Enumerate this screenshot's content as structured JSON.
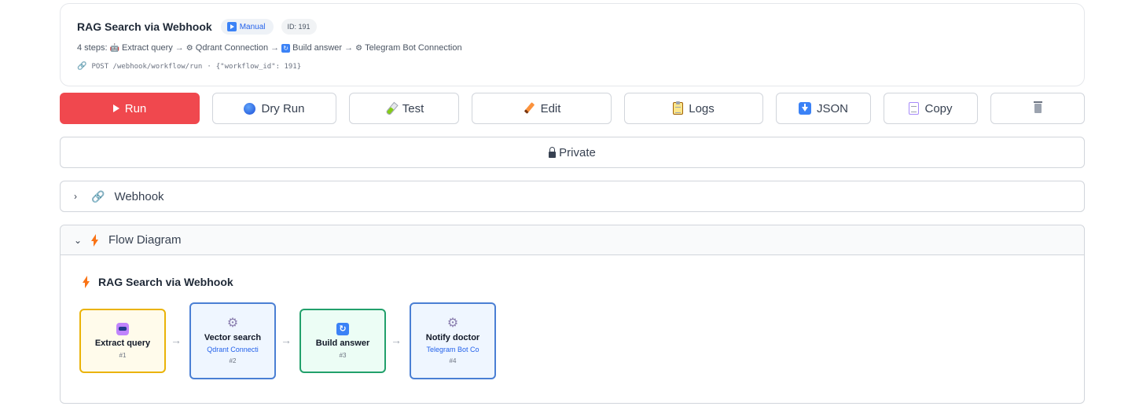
{
  "workflow": {
    "title": "RAG Search via Webhook",
    "trigger_badge": "Manual",
    "id_badge": "ID: 191",
    "steps_prefix": "4 steps:",
    "steps": [
      "Extract query",
      "Qdrant Connection",
      "Build answer",
      "Telegram Bot Connection"
    ],
    "step_separator": "→",
    "endpoint_method_path": "POST /webhook/workflow/run",
    "endpoint_dot": "·",
    "endpoint_body": "{\"workflow_id\": 191}"
  },
  "toolbar": {
    "run": "Run",
    "dry_run": "Dry Run",
    "test": "Test",
    "edit": "Edit",
    "logs": "Logs",
    "json": "JSON",
    "copy": "Copy"
  },
  "visibility": {
    "label": "Private"
  },
  "sections": {
    "webhook": {
      "label": "Webhook",
      "chevron": "›",
      "expanded": false
    },
    "flow": {
      "label": "Flow Diagram",
      "chevron": "⌄",
      "expanded": true
    }
  },
  "flow_diagram": {
    "title": "RAG Search via Webhook",
    "arrow": "→",
    "nodes": [
      {
        "title": "Extract query",
        "subtitle": "",
        "number": "#1",
        "icon": "robot-icon",
        "color": "#eab308"
      },
      {
        "title": "Vector search",
        "subtitle": "Qdrant Connecti",
        "number": "#2",
        "icon": "gear-icon",
        "color": "#4a7fd4"
      },
      {
        "title": "Build answer",
        "subtitle": "",
        "number": "#3",
        "icon": "cycle-icon",
        "color": "#22a06b"
      },
      {
        "title": "Notify doctor",
        "subtitle": "Telegram Bot Co",
        "number": "#4",
        "icon": "gear-icon",
        "color": "#4a7fd4"
      }
    ]
  },
  "colors": {
    "run_button": "#f0484e",
    "accent_blue": "#2563eb"
  }
}
